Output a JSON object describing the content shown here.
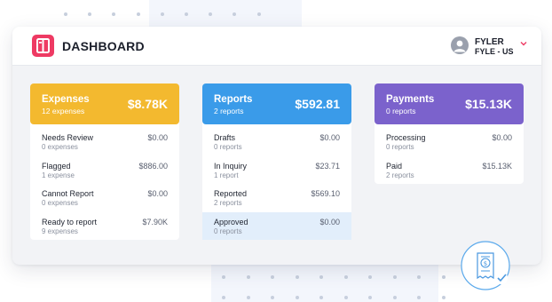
{
  "header": {
    "title": "DASHBOARD",
    "user_name": "FYLER",
    "user_org": "FYLE - US"
  },
  "colors": {
    "expenses": "#f3b92f",
    "reports": "#3a9be9",
    "payments": "#7b62cc",
    "brand": "#ee3a63",
    "highlight": "#e2eefb"
  },
  "cards": [
    {
      "title": "Expenses",
      "subtitle": "12 expenses",
      "amount": "$8.78K",
      "rows": [
        {
          "label": "Needs Review",
          "sub": "0 expenses",
          "value": "$0.00"
        },
        {
          "label": "Flagged",
          "sub": "1 expense",
          "value": "$886.00"
        },
        {
          "label": "Cannot Report",
          "sub": "0 expenses",
          "value": "$0.00"
        },
        {
          "label": "Ready to report",
          "sub": "9 expenses",
          "value": "$7.90K"
        }
      ]
    },
    {
      "title": "Reports",
      "subtitle": "2 reports",
      "amount": "$592.81",
      "rows": [
        {
          "label": "Drafts",
          "sub": "0 reports",
          "value": "$0.00"
        },
        {
          "label": "In Inquiry",
          "sub": "1 report",
          "value": "$23.71"
        },
        {
          "label": "Reported",
          "sub": "2 reports",
          "value": "$569.10"
        },
        {
          "label": "Approved",
          "sub": "0 reports",
          "value": "$0.00"
        }
      ]
    },
    {
      "title": "Payments",
      "subtitle": "0 reports",
      "amount": "$15.13K",
      "rows": [
        {
          "label": "Processing",
          "sub": "0 reports",
          "value": "$0.00"
        },
        {
          "label": "Paid",
          "sub": "2 reports",
          "value": "$15.13K"
        }
      ]
    }
  ],
  "icons": {
    "logo": "fyle-logo-icon",
    "avatar": "user-avatar-icon",
    "menu": "chevron-down-icon",
    "decoration": "receipt-icon"
  }
}
